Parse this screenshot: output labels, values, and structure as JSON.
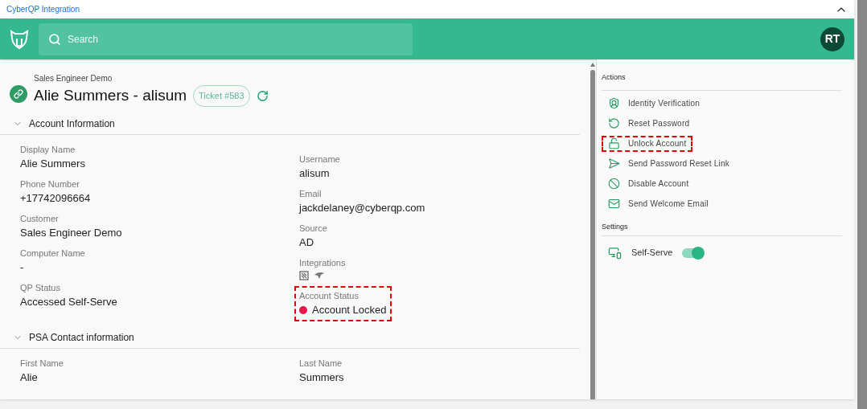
{
  "app_bar": {
    "title": "CyberQP Integration"
  },
  "header": {
    "search": {
      "placeholder": "Search"
    },
    "avatar": "RT"
  },
  "page": {
    "subtitle": "Sales Engineer Demo",
    "title": "Alie Summers - alisum",
    "ticket": "Ticket #583"
  },
  "sections": [
    {
      "title": "Account Information",
      "expanded": true,
      "columns": [
        [
          {
            "kind": "text",
            "label": "Display Name",
            "value": "Alie Summers"
          },
          {
            "kind": "text",
            "label": "Phone Number",
            "value": "+17742096664"
          },
          {
            "kind": "text",
            "label": "Customer",
            "value": "Sales Engineer Demo"
          },
          {
            "kind": "text",
            "label": "Computer Name",
            "value": "-"
          },
          {
            "kind": "text",
            "label": "QP Status",
            "value": "Accessed Self-Serve"
          }
        ],
        [
          {
            "kind": "text",
            "label": "Username",
            "value": "alisum"
          },
          {
            "kind": "text",
            "label": "Email",
            "value": "jackdelaney@cyberqp.com"
          },
          {
            "kind": "text",
            "label": "Source",
            "value": "AD"
          },
          {
            "kind": "icons",
            "label": "Integrations"
          },
          {
            "kind": "status",
            "label": "Account Status",
            "value": "Account Locked",
            "color": "#e8164a",
            "highlighted": true
          }
        ]
      ]
    },
    {
      "title": "PSA Contact information",
      "expanded": true,
      "columns": [
        [
          {
            "kind": "text",
            "label": "First Name",
            "value": "Alie"
          }
        ],
        [
          {
            "kind": "text",
            "label": "Last Name",
            "value": "Summers"
          }
        ]
      ]
    }
  ],
  "actions": {
    "title": "Actions",
    "items": [
      {
        "kind": "identity",
        "label": "Identity Verification",
        "highlighted": false
      },
      {
        "kind": "reset",
        "label": "Reset Password",
        "highlighted": false
      },
      {
        "kind": "unlock",
        "label": "Unlock Account",
        "highlighted": true
      },
      {
        "kind": "send",
        "label": "Send Password Reset Link",
        "highlighted": false
      },
      {
        "kind": "disable",
        "label": "Disable Account",
        "highlighted": false
      },
      {
        "kind": "email",
        "label": "Send Welcome Email",
        "highlighted": false
      }
    ]
  },
  "settings": {
    "title": "Settings",
    "items": [
      {
        "label": "Self-Serve",
        "on": true
      }
    ]
  }
}
